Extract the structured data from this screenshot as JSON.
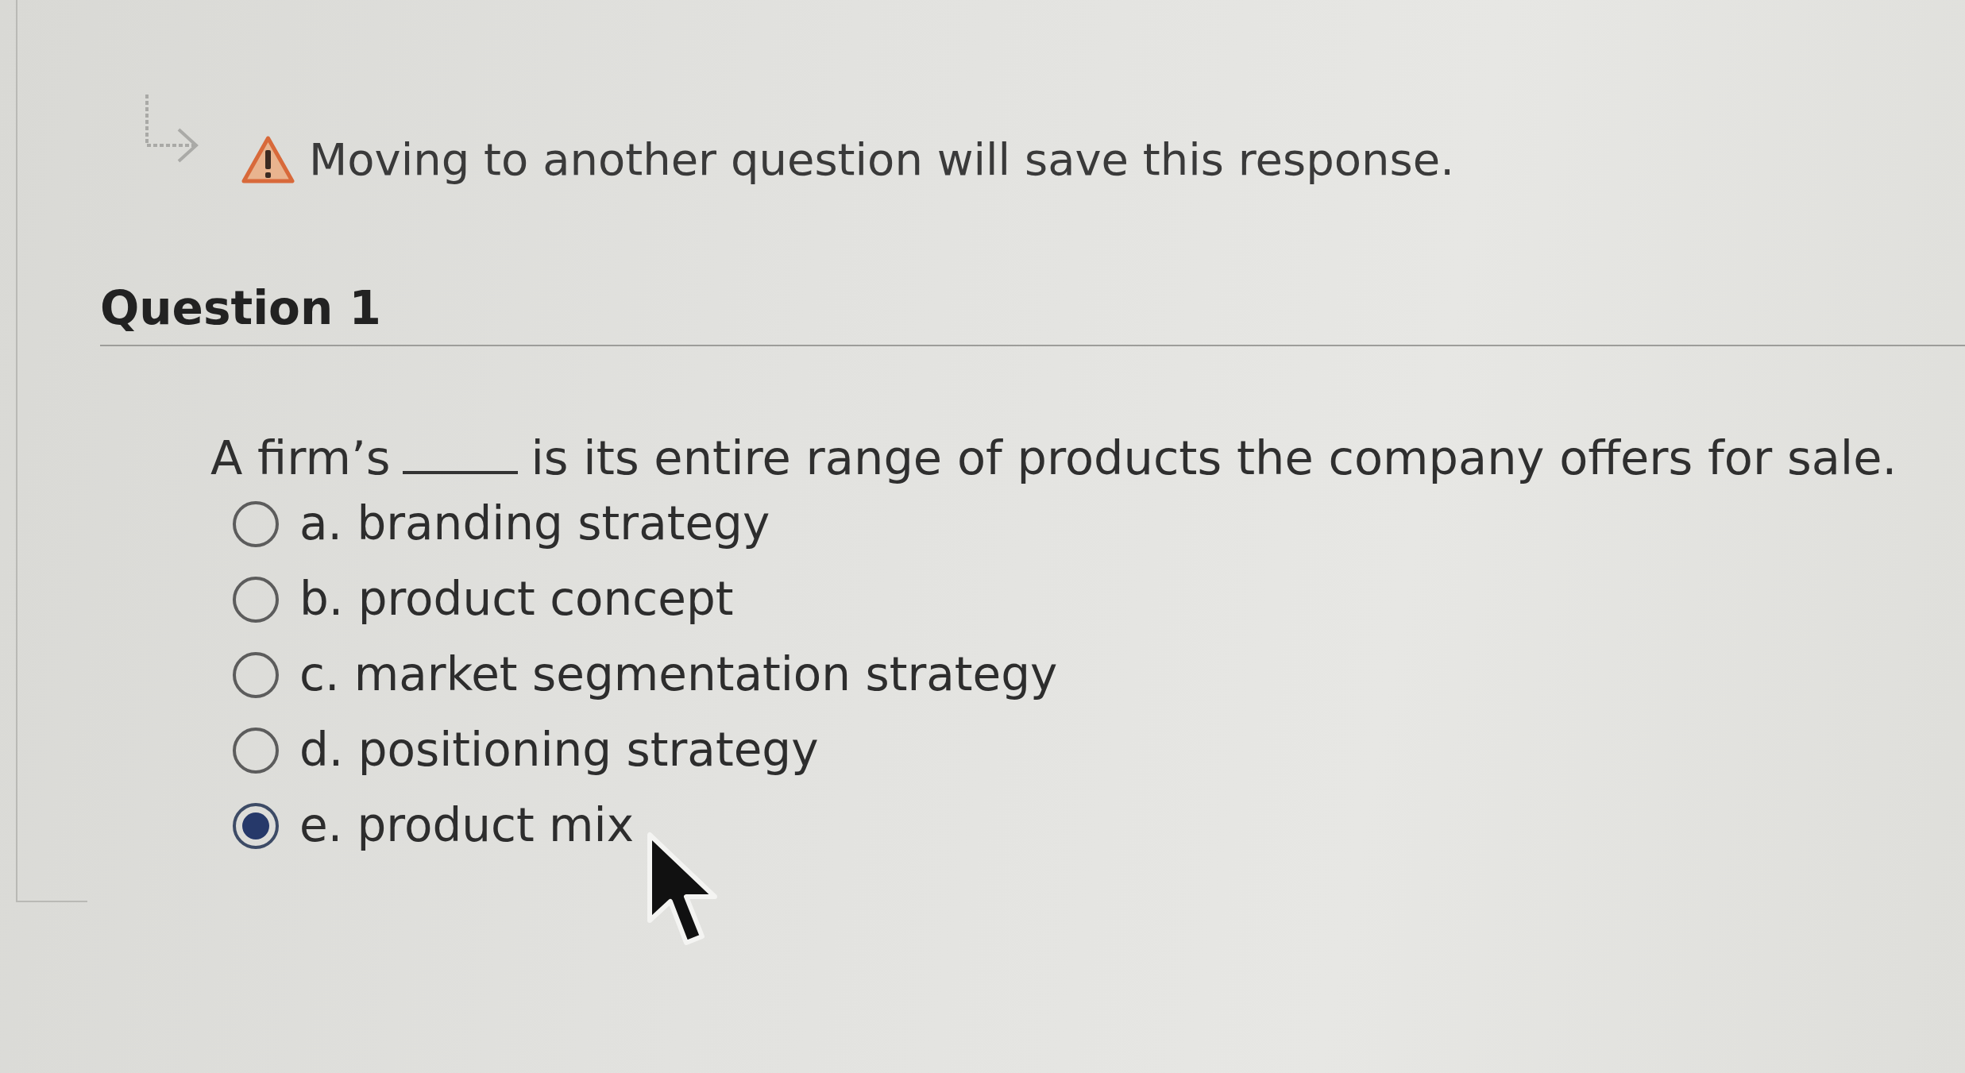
{
  "notice": {
    "message": "Moving to another question will save this response."
  },
  "question": {
    "heading": "Question 1",
    "text_before": "A firm’s",
    "text_after": "is its entire range of products the company offers for sale."
  },
  "options": [
    {
      "label": "a. branding strategy",
      "selected": false
    },
    {
      "label": "b. product concept",
      "selected": false
    },
    {
      "label": "c. market segmentation strategy",
      "selected": false
    },
    {
      "label": "d. positioning strategy",
      "selected": false
    },
    {
      "label": "e. product mix",
      "selected": true
    }
  ]
}
